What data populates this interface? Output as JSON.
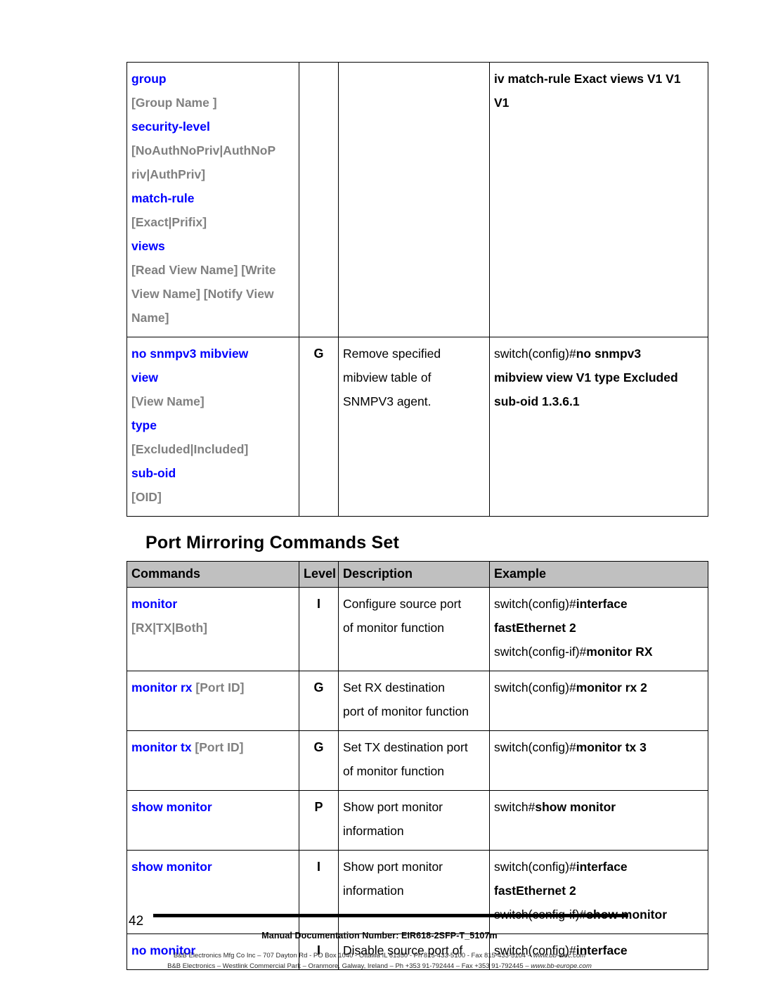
{
  "document": {
    "page_number": "42",
    "footer_doc_line": "Manual Documentation Number: EIR618-2SFP-T_5107m",
    "footer_address_line1_pre": "B&B Electronics Mfg Co Inc – 707 Dayton Rd - PO Box 1040 - Ottawa IL 61350 - Ph 815-433-5100 - Fax 815-433-5104 – ",
    "footer_address_line1_url": "www.bb-elec.com",
    "footer_address_line2_pre": "B&B Electronics – Westlink Commercial Park – Oranmore, Galway, Ireland – Ph +353 91-792444 – Fax +353 91-792445 – ",
    "footer_address_line2_url": "www.bb-europe.com"
  },
  "colors": {
    "keyword_blue": "#0000FF",
    "placeholder_gray": "#808080",
    "header_gray": "#C0C0C0",
    "border_black": "#000000"
  },
  "snmp_table": {
    "rows": [
      {
        "command_lines": [
          {
            "text": "group",
            "style": "keyword"
          },
          {
            "text": "[Group Name ]",
            "style": "placeholder"
          },
          {
            "text": "security-level",
            "style": "keyword"
          },
          {
            "text": "[NoAuthNoPriv|AuthNoP",
            "style": "placeholder"
          },
          {
            "text": "riv|AuthPriv]",
            "style": "placeholder"
          },
          {
            "text": "match-rule",
            "style": "keyword"
          },
          {
            "text": "[Exact|Prifix]",
            "style": "placeholder"
          },
          {
            "text": "views",
            "style": "keyword"
          },
          {
            "text": "[Read View Name] [Write",
            "style": "placeholder"
          },
          {
            "text": "View Name] [Notify View",
            "style": "placeholder"
          },
          {
            "text": "Name]",
            "style": "placeholder"
          }
        ],
        "level": "",
        "description_lines": [],
        "example_lines": [
          {
            "text": "iv match-rule Exact views V1 V1",
            "style": "bold"
          },
          {
            "text": "V1",
            "style": "bold"
          }
        ]
      },
      {
        "command_lines": [
          {
            "text": "no snmpv3 mibview",
            "style": "keyword"
          },
          {
            "text": "view",
            "style": "keyword"
          },
          {
            "text": "[View Name]",
            "style": "placeholder"
          },
          {
            "text": "type",
            "style": "keyword"
          },
          {
            "text": "[Excluded|Included]",
            "style": "placeholder"
          },
          {
            "text": "sub-oid",
            "style": "keyword"
          },
          {
            "text": "[OID]",
            "style": "placeholder"
          }
        ],
        "level": "G",
        "description_lines": [
          "Remove specified",
          "mibview table of",
          "SNMPV3 agent."
        ],
        "example_lines": [
          {
            "prompt": "switch(config)#",
            "command": "no snmpv3"
          },
          {
            "prompt": "",
            "command": "mibview view V1 type Excluded"
          },
          {
            "prompt": "",
            "command": "sub-oid 1.3.6.1"
          }
        ]
      }
    ]
  },
  "port_mirroring": {
    "heading": "Port Mirroring Commands Set",
    "headers": {
      "commands": "Commands",
      "level": "Level",
      "description": "Description",
      "example": "Example"
    },
    "rows": [
      {
        "command_lines": [
          {
            "text": "monitor",
            "style": "keyword"
          },
          {
            "text": "[RX|TX|Both]",
            "style": "placeholder"
          }
        ],
        "level": "I",
        "description_lines": [
          "Configure source port",
          "of monitor function"
        ],
        "example_lines": [
          {
            "prompt": "switch(config)#",
            "command": "interface"
          },
          {
            "prompt": "",
            "command": "fastEthernet 2"
          },
          {
            "prompt": "switch(config-if)#",
            "command": "monitor RX"
          }
        ]
      },
      {
        "command_lines": [
          {
            "text": "monitor rx ",
            "style": "keyword",
            "suffix": "[Port ID]",
            "suffix_style": "placeholder"
          }
        ],
        "level": "G",
        "description_lines": [
          "Set RX destination",
          "port of monitor function"
        ],
        "example_lines": [
          {
            "prompt": "switch(config)#",
            "command": "monitor rx 2"
          }
        ]
      },
      {
        "command_lines": [
          {
            "text": "monitor tx ",
            "style": "keyword",
            "suffix": "[Port ID]",
            "suffix_style": "placeholder"
          }
        ],
        "level": "G",
        "description_lines": [
          "Set TX destination port",
          "of monitor function"
        ],
        "example_lines": [
          {
            "prompt": "switch(config)#",
            "command": "monitor tx 3"
          }
        ]
      },
      {
        "command_lines": [
          {
            "text": "show monitor",
            "style": "keyword"
          }
        ],
        "level": "P",
        "description_lines": [
          "Show port monitor",
          "information"
        ],
        "example_lines": [
          {
            "prompt": "switch#",
            "command": "show monitor"
          }
        ]
      },
      {
        "command_lines": [
          {
            "text": "show monitor",
            "style": "keyword"
          }
        ],
        "level": "I",
        "description_lines": [
          "Show port monitor",
          "information"
        ],
        "example_lines": [
          {
            "prompt": "switch(config)#",
            "command": "interface"
          },
          {
            "prompt": "",
            "command": "fastEthernet 2"
          },
          {
            "prompt": "switch(config-if)#",
            "command": "show monitor"
          }
        ]
      },
      {
        "command_lines": [
          {
            "text": "no monitor",
            "style": "keyword"
          }
        ],
        "level": "I",
        "description_lines": [
          "Disable source port of"
        ],
        "example_lines": [
          {
            "prompt": "switch(config)#",
            "command": "interface"
          }
        ]
      }
    ]
  }
}
